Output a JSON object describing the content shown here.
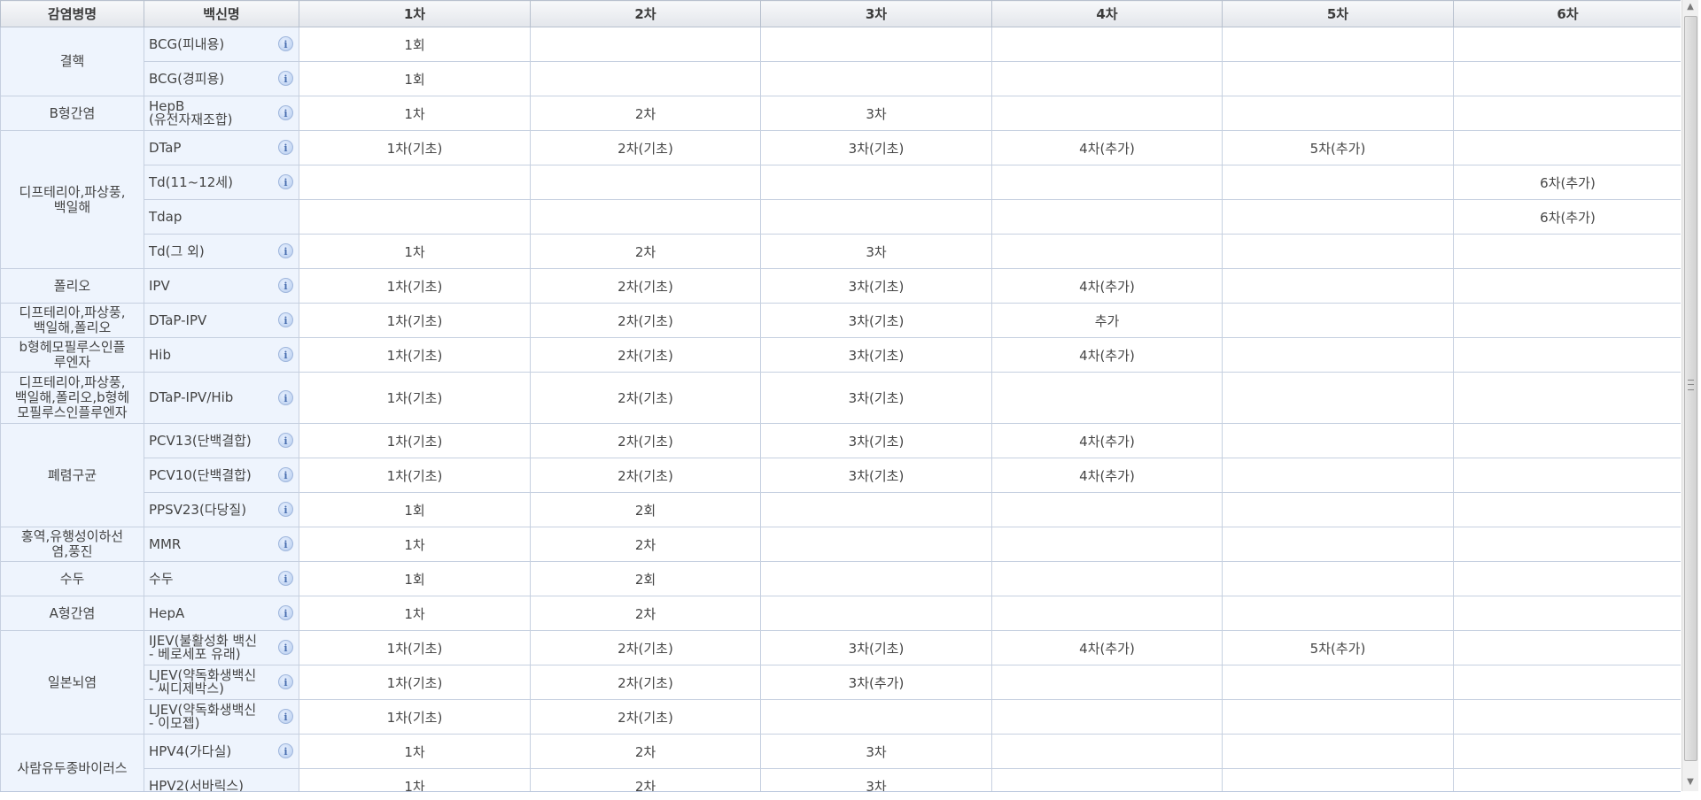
{
  "headers": [
    "감염병명",
    "백신명",
    "1차",
    "2차",
    "3차",
    "4차",
    "5차",
    "6차"
  ],
  "info_glyph": "i",
  "groups": [
    {
      "disease": "결핵",
      "rows": [
        {
          "vaccine": "BCG(피내용)",
          "info": true,
          "doses": [
            "1회",
            "",
            "",
            "",
            "",
            ""
          ]
        },
        {
          "vaccine": "BCG(경피용)",
          "info": true,
          "doses": [
            "1회",
            "",
            "",
            "",
            "",
            ""
          ]
        }
      ]
    },
    {
      "disease": "B형간염",
      "rows": [
        {
          "vaccine": "HepB\n(유전자재조합)",
          "info": true,
          "doses": [
            "1차",
            "2차",
            "3차",
            "",
            "",
            ""
          ]
        }
      ]
    },
    {
      "disease": "디프테리아,파상풍,\n백일해",
      "rows": [
        {
          "vaccine": "DTaP",
          "info": true,
          "doses": [
            "1차(기초)",
            "2차(기초)",
            "3차(기초)",
            "4차(추가)",
            "5차(추가)",
            ""
          ]
        },
        {
          "vaccine": "Td(11~12세)",
          "info": true,
          "doses": [
            "",
            "",
            "",
            "",
            "",
            "6차(추가)"
          ]
        },
        {
          "vaccine": "Tdap",
          "info": false,
          "doses": [
            "",
            "",
            "",
            "",
            "",
            "6차(추가)"
          ]
        },
        {
          "vaccine": "Td(그 외)",
          "info": true,
          "doses": [
            "1차",
            "2차",
            "3차",
            "",
            "",
            ""
          ]
        }
      ]
    },
    {
      "disease": "폴리오",
      "rows": [
        {
          "vaccine": "IPV",
          "info": true,
          "doses": [
            "1차(기초)",
            "2차(기초)",
            "3차(기초)",
            "4차(추가)",
            "",
            ""
          ]
        }
      ]
    },
    {
      "disease": "디프테리아,파상풍,\n백일해,폴리오",
      "rows": [
        {
          "vaccine": "DTaP-IPV",
          "info": true,
          "doses": [
            "1차(기초)",
            "2차(기초)",
            "3차(기초)",
            "추가",
            "",
            ""
          ]
        }
      ]
    },
    {
      "disease": "b형헤모필루스인플\n루엔자",
      "rows": [
        {
          "vaccine": "Hib",
          "info": true,
          "doses": [
            "1차(기초)",
            "2차(기초)",
            "3차(기초)",
            "4차(추가)",
            "",
            ""
          ]
        }
      ]
    },
    {
      "disease": "디프테리아,파상풍,\n백일해,폴리오,b형헤\n모필루스인플루엔자",
      "tall": true,
      "rows": [
        {
          "vaccine": "DTaP-IPV/Hib",
          "info": true,
          "doses": [
            "1차(기초)",
            "2차(기초)",
            "3차(기초)",
            "",
            "",
            ""
          ]
        }
      ]
    },
    {
      "disease": "폐렴구균",
      "rows": [
        {
          "vaccine": "PCV13(단백결합)",
          "info": true,
          "doses": [
            "1차(기초)",
            "2차(기초)",
            "3차(기초)",
            "4차(추가)",
            "",
            ""
          ]
        },
        {
          "vaccine": "PCV10(단백결합)",
          "info": true,
          "doses": [
            "1차(기초)",
            "2차(기초)",
            "3차(기초)",
            "4차(추가)",
            "",
            ""
          ]
        },
        {
          "vaccine": "PPSV23(다당질)",
          "info": true,
          "doses": [
            "1회",
            "2회",
            "",
            "",
            "",
            ""
          ]
        }
      ]
    },
    {
      "disease": "홍역,유행성이하선\n염,풍진",
      "rows": [
        {
          "vaccine": "MMR",
          "info": true,
          "doses": [
            "1차",
            "2차",
            "",
            "",
            "",
            ""
          ]
        }
      ]
    },
    {
      "disease": "수두",
      "rows": [
        {
          "vaccine": "수두",
          "info": true,
          "doses": [
            "1회",
            "2회",
            "",
            "",
            "",
            ""
          ]
        }
      ]
    },
    {
      "disease": "A형간염",
      "rows": [
        {
          "vaccine": "HepA",
          "info": true,
          "doses": [
            "1차",
            "2차",
            "",
            "",
            "",
            ""
          ]
        }
      ]
    },
    {
      "disease": "일본뇌염",
      "rows": [
        {
          "vaccine": "IJEV(불활성화 백신\n- 베로세포 유래)",
          "info": true,
          "doses": [
            "1차(기초)",
            "2차(기초)",
            "3차(기초)",
            "4차(추가)",
            "5차(추가)",
            ""
          ]
        },
        {
          "vaccine": "LJEV(약독화생백신\n- 씨디제박스)",
          "info": true,
          "doses": [
            "1차(기초)",
            "2차(기초)",
            "3차(추가)",
            "",
            "",
            ""
          ]
        },
        {
          "vaccine": "LJEV(약독화생백신\n- 이모젭)",
          "info": true,
          "doses": [
            "1차(기초)",
            "2차(기초)",
            "",
            "",
            "",
            ""
          ]
        }
      ]
    },
    {
      "disease": "사람유두종바이러스",
      "rows": [
        {
          "vaccine": "HPV4(가다실)",
          "info": true,
          "doses": [
            "1차",
            "2차",
            "3차",
            "",
            "",
            ""
          ]
        },
        {
          "vaccine": "HPV2(서바릭스)",
          "info": false,
          "doses": [
            "1차",
            "2차",
            "3차",
            "",
            "",
            ""
          ]
        }
      ]
    }
  ],
  "scrollbar": {
    "up_arrow": "▲",
    "down_arrow": "▼"
  }
}
